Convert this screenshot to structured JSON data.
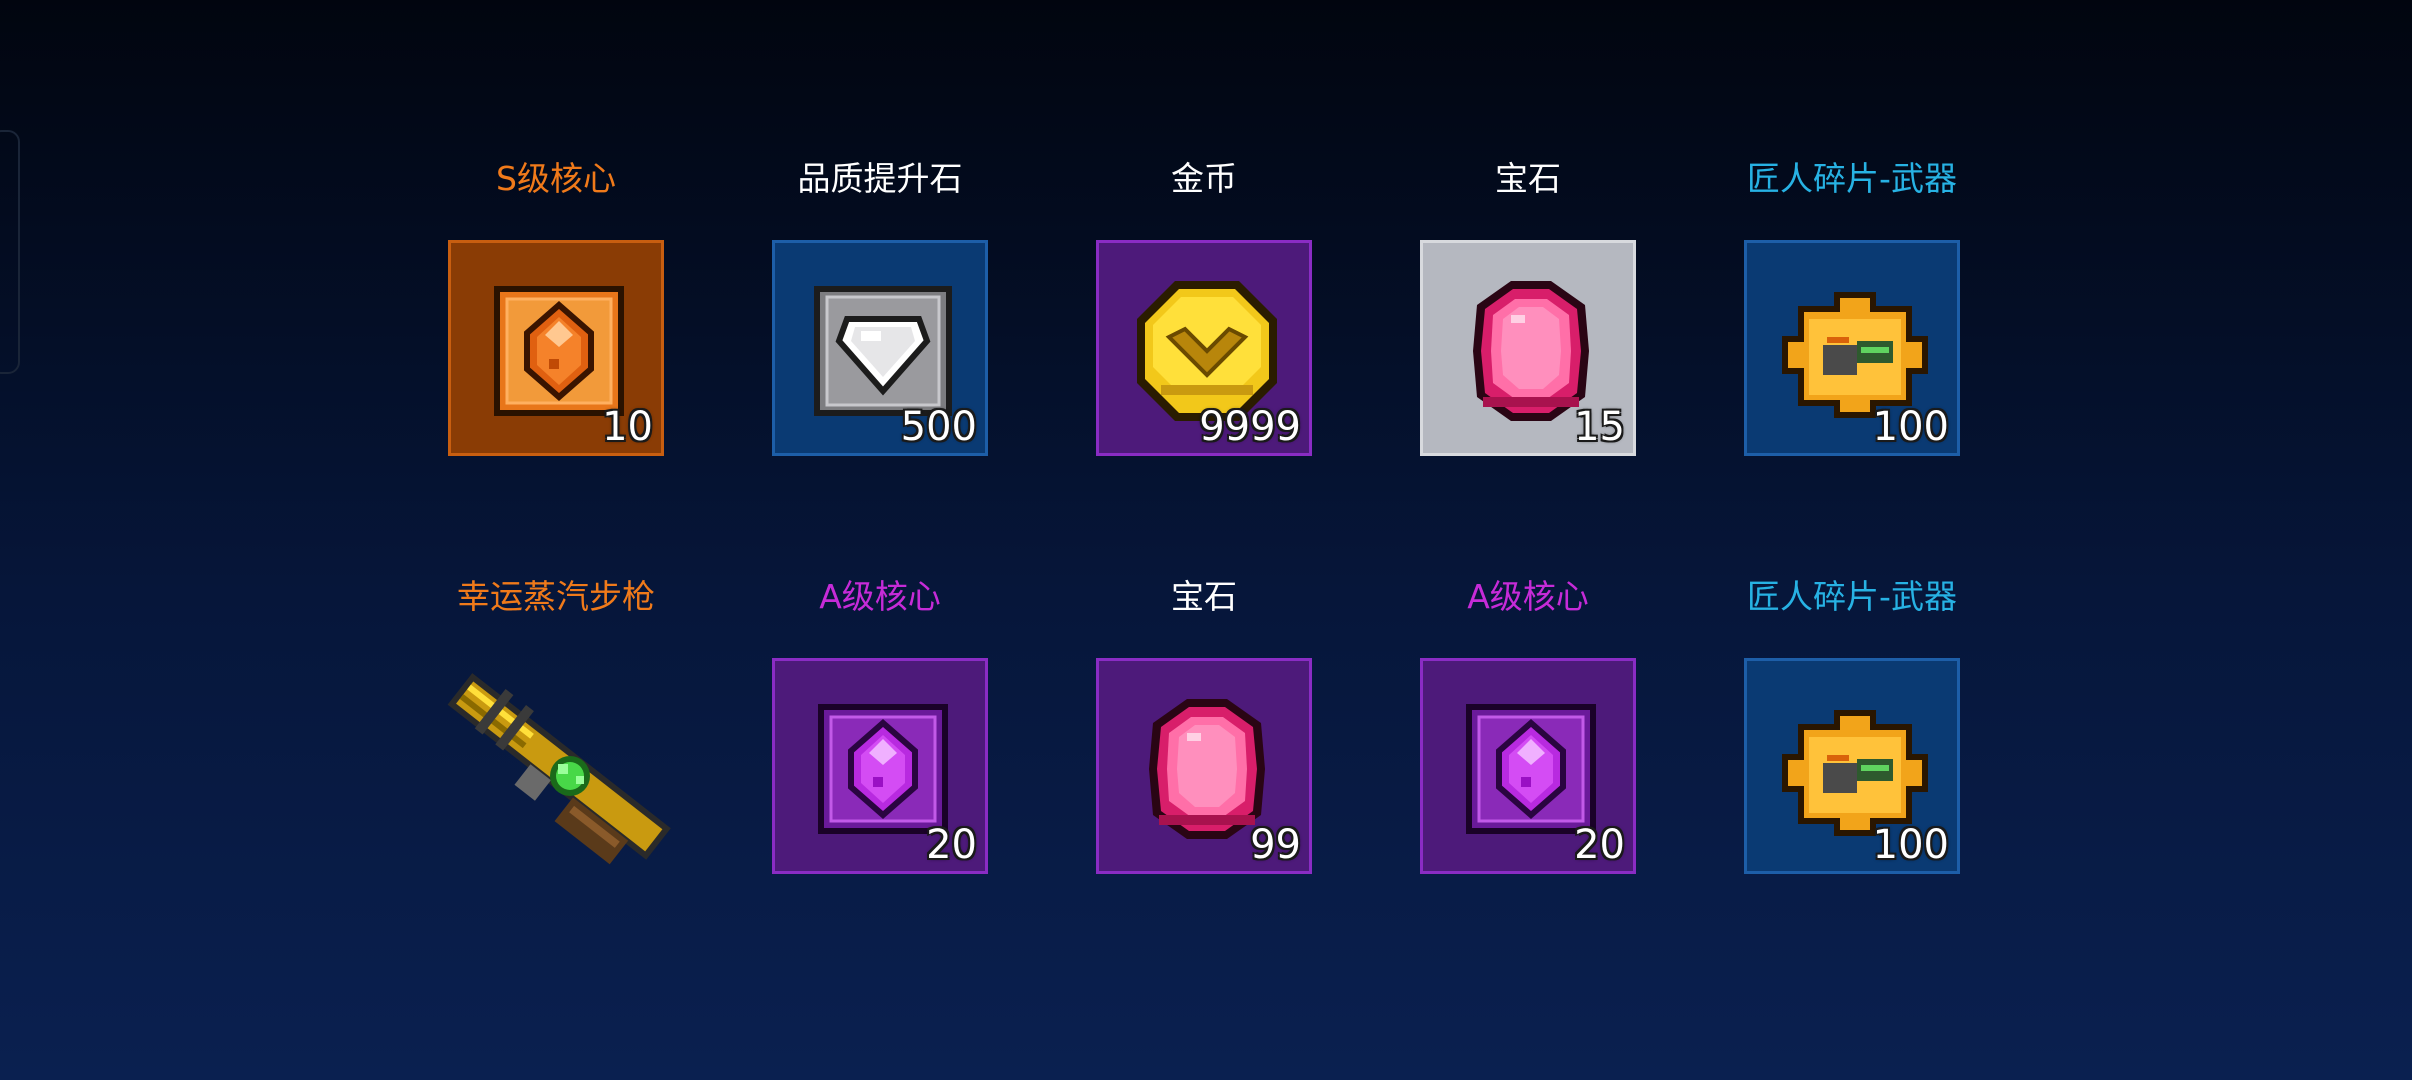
{
  "colors": {
    "orange_text": "#f07a1a",
    "white_text": "#ffffff",
    "cyan_text": "#27b2e4",
    "purple_text": "#c62bd8",
    "tile_orange": "#8a3c05",
    "tile_blue": "#0a3a73",
    "tile_purple": "#4d1a7a",
    "tile_gray": "#b5b8c0"
  },
  "rewards": [
    {
      "name": "S级核心",
      "count": "10",
      "icon": "s-core-icon",
      "name_color": "#f07a1a",
      "tile": "orange"
    },
    {
      "name": "品质提升石",
      "count": "500",
      "icon": "quality-stone-icon",
      "name_color": "#ffffff",
      "tile": "blue"
    },
    {
      "name": "金币",
      "count": "9999",
      "icon": "gold-coin-icon",
      "name_color": "#ffffff",
      "tile": "purple"
    },
    {
      "name": "宝石",
      "count": "15",
      "icon": "gem-icon",
      "name_color": "#ffffff",
      "tile": "gray"
    },
    {
      "name": "匠人碎片-武器",
      "count": "100",
      "icon": "puzzle-piece-icon",
      "name_color": "#27b2e4",
      "tile": "blue"
    },
    {
      "name": "幸运蒸汽步枪",
      "count": "",
      "icon": "steam-rifle-icon",
      "name_color": "#f07a1a",
      "tile": "none"
    },
    {
      "name": "A级核心",
      "count": "20",
      "icon": "a-core-icon",
      "name_color": "#c62bd8",
      "tile": "purple"
    },
    {
      "name": "宝石",
      "count": "99",
      "icon": "gem-icon",
      "name_color": "#ffffff",
      "tile": "purple"
    },
    {
      "name": "A级核心",
      "count": "20",
      "icon": "a-core-icon",
      "name_color": "#c62bd8",
      "tile": "purple"
    },
    {
      "name": "匠人碎片-武器",
      "count": "100",
      "icon": "puzzle-piece-icon",
      "name_color": "#27b2e4",
      "tile": "blue"
    }
  ]
}
